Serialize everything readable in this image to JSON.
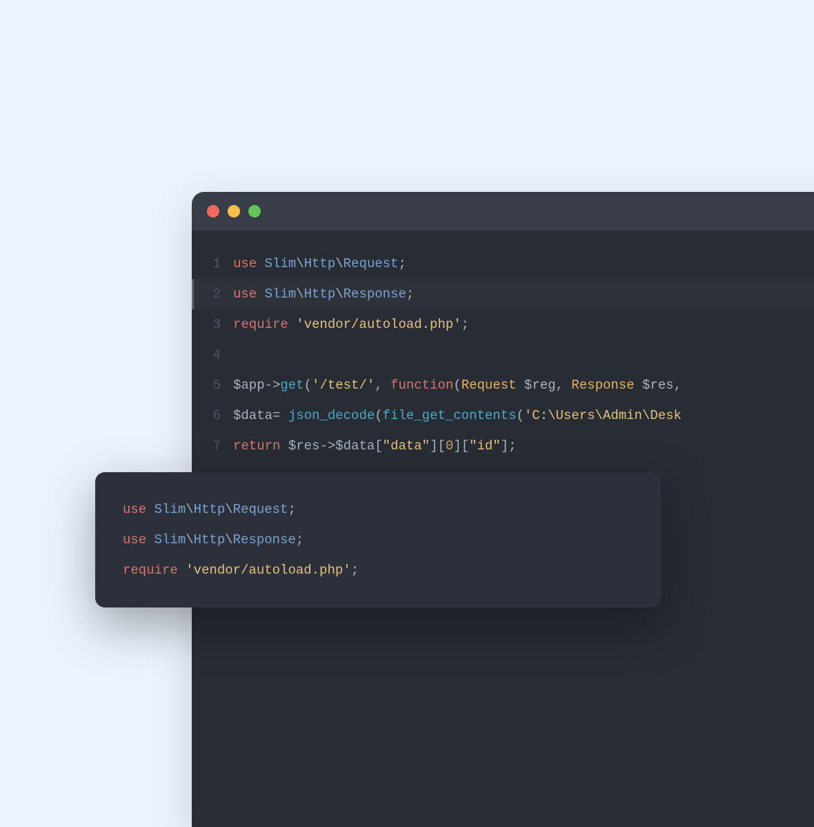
{
  "editor": {
    "lines": [
      {
        "num": "1",
        "tokens": [
          {
            "t": "use ",
            "c": "tk-keyword"
          },
          {
            "t": "Slim",
            "c": "tk-type"
          },
          {
            "t": "\\",
            "c": "tk-punct"
          },
          {
            "t": "Http",
            "c": "tk-type"
          },
          {
            "t": "\\",
            "c": "tk-punct"
          },
          {
            "t": "Request",
            "c": "tk-type"
          },
          {
            "t": ";",
            "c": "tk-punct"
          }
        ],
        "highlighted": false
      },
      {
        "num": "2",
        "tokens": [
          {
            "t": "use ",
            "c": "tk-keyword"
          },
          {
            "t": "Slim",
            "c": "tk-type"
          },
          {
            "t": "\\",
            "c": "tk-punct"
          },
          {
            "t": "Http",
            "c": "tk-type"
          },
          {
            "t": "\\",
            "c": "tk-punct"
          },
          {
            "t": "Response",
            "c": "tk-type"
          },
          {
            "t": ";",
            "c": "tk-punct"
          }
        ],
        "highlighted": true
      },
      {
        "num": "3",
        "tokens": [
          {
            "t": "require ",
            "c": "tk-keyword"
          },
          {
            "t": "'vendor/autoload.php'",
            "c": "tk-string"
          },
          {
            "t": ";",
            "c": "tk-punct"
          }
        ],
        "highlighted": false
      },
      {
        "num": "4",
        "tokens": [],
        "highlighted": false
      },
      {
        "num": "5",
        "tokens": [
          {
            "t": "$app",
            "c": "tk-var"
          },
          {
            "t": "->",
            "c": "tk-punct"
          },
          {
            "t": "get",
            "c": "tk-func"
          },
          {
            "t": "(",
            "c": "tk-punct"
          },
          {
            "t": "'/test/'",
            "c": "tk-string"
          },
          {
            "t": ", ",
            "c": "tk-punct"
          },
          {
            "t": "function",
            "c": "tk-keyword"
          },
          {
            "t": "(",
            "c": "tk-punct"
          },
          {
            "t": "Request",
            "c": "tk-class"
          },
          {
            "t": " $reg, ",
            "c": "tk-var"
          },
          {
            "t": "Response",
            "c": "tk-class"
          },
          {
            "t": " $res,",
            "c": "tk-var"
          }
        ],
        "highlighted": false
      },
      {
        "num": "6",
        "tokens": [
          {
            "t": "$data",
            "c": "tk-var"
          },
          {
            "t": "= ",
            "c": "tk-punct"
          },
          {
            "t": "json_decode",
            "c": "tk-func"
          },
          {
            "t": "(",
            "c": "tk-punct"
          },
          {
            "t": "file_get_contents",
            "c": "tk-func"
          },
          {
            "t": "(",
            "c": "tk-punct"
          },
          {
            "t": "'C:\\Users\\Admin\\Desk",
            "c": "tk-string"
          }
        ],
        "highlighted": false
      },
      {
        "num": "7",
        "tokens": [
          {
            "t": "return ",
            "c": "tk-keyword"
          },
          {
            "t": "$res",
            "c": "tk-var"
          },
          {
            "t": "->",
            "c": "tk-punct"
          },
          {
            "t": "$data",
            "c": "tk-var"
          },
          {
            "t": "[",
            "c": "tk-punct"
          },
          {
            "t": "\"data\"",
            "c": "tk-string"
          },
          {
            "t": "][",
            "c": "tk-punct"
          },
          {
            "t": "0",
            "c": "tk-num"
          },
          {
            "t": "][",
            "c": "tk-punct"
          },
          {
            "t": "\"id\"",
            "c": "tk-string"
          },
          {
            "t": "];",
            "c": "tk-punct"
          }
        ],
        "highlighted": false
      }
    ]
  },
  "tooltip": {
    "lines": [
      {
        "tokens": [
          {
            "t": "use ",
            "c": "tk-keyword"
          },
          {
            "t": "Slim",
            "c": "tk-type"
          },
          {
            "t": "\\",
            "c": "tk-punct"
          },
          {
            "t": "Http",
            "c": "tk-type"
          },
          {
            "t": "\\",
            "c": "tk-punct"
          },
          {
            "t": "Request",
            "c": "tk-type"
          },
          {
            "t": ";",
            "c": "tk-punct"
          }
        ]
      },
      {
        "tokens": [
          {
            "t": "use ",
            "c": "tk-keyword"
          },
          {
            "t": "Slim",
            "c": "tk-type"
          },
          {
            "t": "\\",
            "c": "tk-punct"
          },
          {
            "t": "Http",
            "c": "tk-type"
          },
          {
            "t": "\\",
            "c": "tk-punct"
          },
          {
            "t": "Response",
            "c": "tk-type"
          },
          {
            "t": ";",
            "c": "tk-punct"
          }
        ]
      },
      {
        "tokens": [
          {
            "t": "require ",
            "c": "tk-keyword"
          },
          {
            "t": "'vendor/autoload.php'",
            "c": "tk-string"
          },
          {
            "t": ";",
            "c": "tk-punct"
          }
        ]
      }
    ]
  }
}
